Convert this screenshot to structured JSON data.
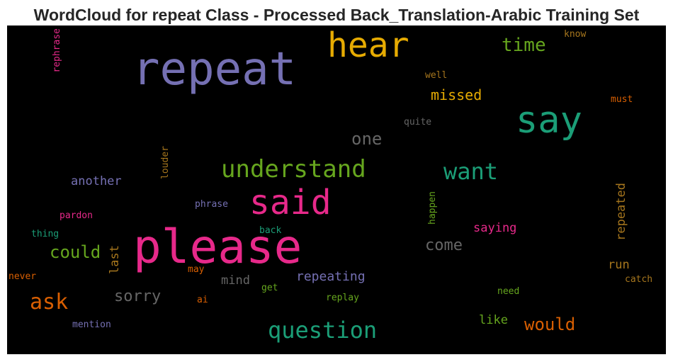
{
  "title": "WordCloud for repeat Class - Processed Back_Translation-Arabic Training Set",
  "words": [
    {
      "text": "repeat",
      "color": "#7570b3"
    },
    {
      "text": "hear",
      "color": "#e6ab02"
    },
    {
      "text": "time",
      "color": "#66a61e"
    },
    {
      "text": "know",
      "color": "#a6761d"
    },
    {
      "text": "rephrase",
      "color": "#e7298a"
    },
    {
      "text": "well",
      "color": "#a6761d"
    },
    {
      "text": "missed",
      "color": "#e6ab02"
    },
    {
      "text": "must",
      "color": "#d95f02"
    },
    {
      "text": "say",
      "color": "#1b9e77"
    },
    {
      "text": "quite",
      "color": "#666666"
    },
    {
      "text": "one",
      "color": "#666666"
    },
    {
      "text": "louder",
      "color": "#a6761d"
    },
    {
      "text": "understand",
      "color": "#66a61e"
    },
    {
      "text": "want",
      "color": "#1b9e77"
    },
    {
      "text": "another",
      "color": "#7570b3"
    },
    {
      "text": "said",
      "color": "#e7298a"
    },
    {
      "text": "repeated",
      "color": "#a6761d"
    },
    {
      "text": "phrase",
      "color": "#7570b3"
    },
    {
      "text": "happen",
      "color": "#66a61e"
    },
    {
      "text": "pardon",
      "color": "#e7298a"
    },
    {
      "text": "thing",
      "color": "#1b9e77"
    },
    {
      "text": "back",
      "color": "#1b9e77"
    },
    {
      "text": "saying",
      "color": "#e7298a"
    },
    {
      "text": "please",
      "color": "#e7298a"
    },
    {
      "text": "could",
      "color": "#66a61e"
    },
    {
      "text": "come",
      "color": "#666666"
    },
    {
      "text": "last",
      "color": "#a6761d"
    },
    {
      "text": "may",
      "color": "#d95f02"
    },
    {
      "text": "run",
      "color": "#a6761d"
    },
    {
      "text": "never",
      "color": "#d95f02"
    },
    {
      "text": "mind",
      "color": "#666666"
    },
    {
      "text": "repeating",
      "color": "#7570b3"
    },
    {
      "text": "catch",
      "color": "#a6761d"
    },
    {
      "text": "get",
      "color": "#66a61e"
    },
    {
      "text": "ask",
      "color": "#d95f02"
    },
    {
      "text": "sorry",
      "color": "#666666"
    },
    {
      "text": "ai",
      "color": "#d95f02"
    },
    {
      "text": "replay",
      "color": "#66a61e"
    },
    {
      "text": "need",
      "color": "#66a61e"
    },
    {
      "text": "like",
      "color": "#66a61e"
    },
    {
      "text": "would",
      "color": "#d95f02"
    },
    {
      "text": "question",
      "color": "#1b9e77"
    },
    {
      "text": "mention",
      "color": "#7570b3"
    }
  ]
}
